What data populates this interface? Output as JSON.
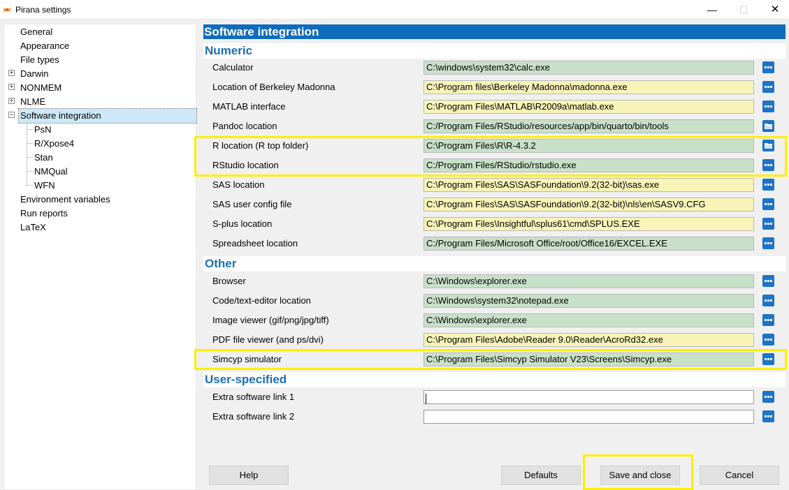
{
  "window": {
    "title": "Pirana settings",
    "controls": {
      "minimize": "—",
      "maximize": "☐",
      "close": "✕"
    }
  },
  "tree": {
    "items": [
      {
        "label": "General",
        "expander": ""
      },
      {
        "label": "Appearance",
        "expander": ""
      },
      {
        "label": "File types",
        "expander": ""
      },
      {
        "label": "Darwin",
        "expander": "+"
      },
      {
        "label": "NONMEM",
        "expander": "+"
      },
      {
        "label": "NLME",
        "expander": "+"
      },
      {
        "label": "Software integration",
        "expander": "−",
        "selected": true
      },
      {
        "label": "PsN",
        "child": true
      },
      {
        "label": "R/Xpose4",
        "child": true
      },
      {
        "label": "Stan",
        "child": true
      },
      {
        "label": "NMQual",
        "child": true
      },
      {
        "label": "WFN",
        "child": true
      },
      {
        "label": "Environment variables",
        "expander": ""
      },
      {
        "label": "Run reports",
        "expander": ""
      },
      {
        "label": "LaTeX",
        "expander": ""
      }
    ]
  },
  "panel": {
    "header": "Software integration",
    "sections": {
      "numeric": {
        "title": "Numeric",
        "rows": [
          {
            "label": "Calculator",
            "value": "C:\\windows\\system32\\calc.exe",
            "status": "green",
            "icon": "dots"
          },
          {
            "label": "Location of Berkeley Madonna",
            "value": "C:\\Program files\\Berkeley Madonna\\madonna.exe",
            "status": "yellow",
            "icon": "dots"
          },
          {
            "label": "MATLAB interface",
            "value": "C:\\Program Files\\MATLAB\\R2009a\\matlab.exe",
            "status": "yellow",
            "icon": "dots"
          },
          {
            "label": "Pandoc location",
            "value": "C:/Program Files/RStudio/resources/app/bin/quarto/bin/tools",
            "status": "green",
            "icon": "folder"
          },
          {
            "label": "R location (R top folder)",
            "value": "C:\\Program Files\\R\\R-4.3.2",
            "status": "green",
            "icon": "folder"
          },
          {
            "label": "RStudio location",
            "value": "C:/Program Files/RStudio/rstudio.exe",
            "status": "green",
            "icon": "dots"
          },
          {
            "label": "SAS location",
            "value": "C:\\Program Files\\SAS\\SASFoundation\\9.2(32-bit)\\sas.exe",
            "status": "yellow",
            "icon": "dots"
          },
          {
            "label": "SAS user config file",
            "value": "C:\\Program Files\\SAS\\SASFoundation\\9.2(32-bit)\\nls\\en\\SASV9.CFG",
            "status": "yellow",
            "icon": "dots"
          },
          {
            "label": "S-plus location",
            "value": "C:\\Program Files\\Insightful\\splus61\\cmd\\SPLUS.EXE",
            "status": "yellow",
            "icon": "dots"
          },
          {
            "label": "Spreadsheet location",
            "value": "C:/Program Files/Microsoft Office/root/Office16/EXCEL.EXE",
            "status": "green",
            "icon": "dots"
          }
        ]
      },
      "other": {
        "title": "Other",
        "rows": [
          {
            "label": "Browser",
            "value": "C:\\Windows\\explorer.exe",
            "status": "green",
            "icon": "dots"
          },
          {
            "label": "Code/text-editor location",
            "value": "C:\\Windows\\system32\\notepad.exe",
            "status": "green",
            "icon": "dots"
          },
          {
            "label": "Image viewer (gif/png/jpg/tiff)",
            "value": "C:\\Windows\\explorer.exe",
            "status": "green",
            "icon": "dots"
          },
          {
            "label": "PDF file viewer (and ps/dvi)",
            "value": "C:\\Program Files\\Adobe\\Reader 9.0\\Reader\\AcroRd32.exe",
            "status": "yellow",
            "icon": "dots"
          },
          {
            "label": "Simcyp simulator",
            "value": "C:\\Program Files\\Simcyp Simulator V23\\Screens\\Simcyp.exe",
            "status": "green",
            "icon": "dots"
          }
        ]
      },
      "user": {
        "title": "User-specified",
        "rows": [
          {
            "label": "Extra software link 1",
            "value": "",
            "status": "white",
            "icon": "dots"
          },
          {
            "label": "Extra software link 2",
            "value": "",
            "status": "white",
            "icon": "dots"
          }
        ]
      }
    }
  },
  "buttons": {
    "help": "Help",
    "defaults": "Defaults",
    "save_close": "Save and close",
    "cancel": "Cancel"
  },
  "colors": {
    "accent": "#0f6cbd",
    "section_text": "#1a6fb5",
    "valid_path": "#c8e0c8",
    "unverified_path": "#f8f4b8",
    "annotation": "#ffef00"
  }
}
